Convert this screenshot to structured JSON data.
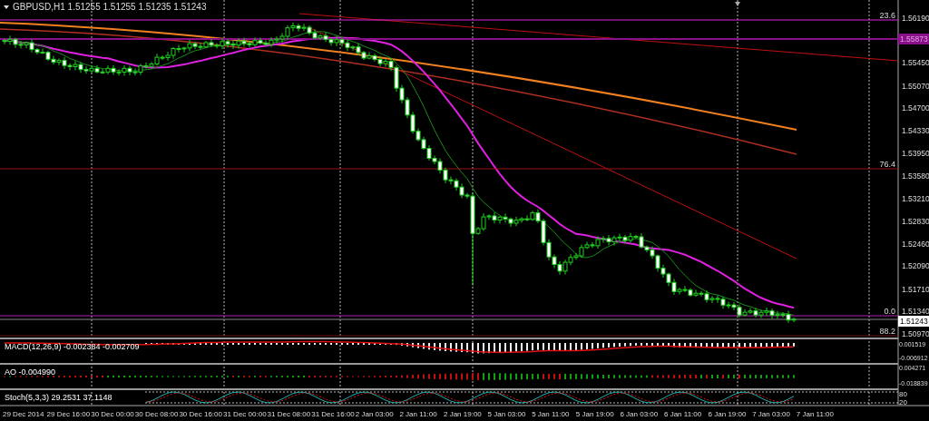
{
  "chart": {
    "symbol": "GBPUSD,H1",
    "ohlc": [
      "1.51255",
      "1.51255",
      "1.51235",
      "1.51243"
    ],
    "price_axis": [
      "1.56190",
      "1.55450",
      "1.55070",
      "1.54700",
      "1.54330",
      "1.53950",
      "1.53580",
      "1.53210",
      "1.52830",
      "1.52460",
      "1.52090",
      "1.51710",
      "1.51340",
      "1.50970"
    ],
    "level_price": "1.55873",
    "current_price": "1.51243",
    "fibo_levels": [
      {
        "label": "23.6"
      },
      {
        "label": "76.4"
      },
      {
        "label": "0.0"
      },
      {
        "label": "88.2"
      }
    ],
    "time_axis": [
      "29 Dec 2014",
      "29 Dec 16:00",
      "30 Dec 00:00",
      "30 Dec 08:00",
      "30 Dec 16:00",
      "31 Dec 00:00",
      "31 Dec 08:00",
      "31 Dec 16:00",
      "2 Jan 03:00",
      "2 Jan 11:00",
      "2 Jan 19:00",
      "5 Jan 03:00",
      "5 Jan 11:00",
      "5 Jan 19:00",
      "6 Jan 03:00",
      "6 Jan 11:00",
      "6 Jan 19:00",
      "7 Jan 03:00",
      "7 Jan 11:00"
    ]
  },
  "indicators": [
    {
      "kind": "macd",
      "label": "MACD(12,26,9) -0.002384 -0.002709",
      "axis": [
        "0.001519",
        "-0.006912"
      ]
    },
    {
      "kind": "ao",
      "label": "AO -0.004990",
      "axis": [
        "0.004271",
        "-0.018839"
      ]
    },
    {
      "kind": "stoch",
      "label": "Stoch(5,3,3) 29.2531 37.1148",
      "axis": [
        "80",
        "20"
      ]
    }
  ]
}
